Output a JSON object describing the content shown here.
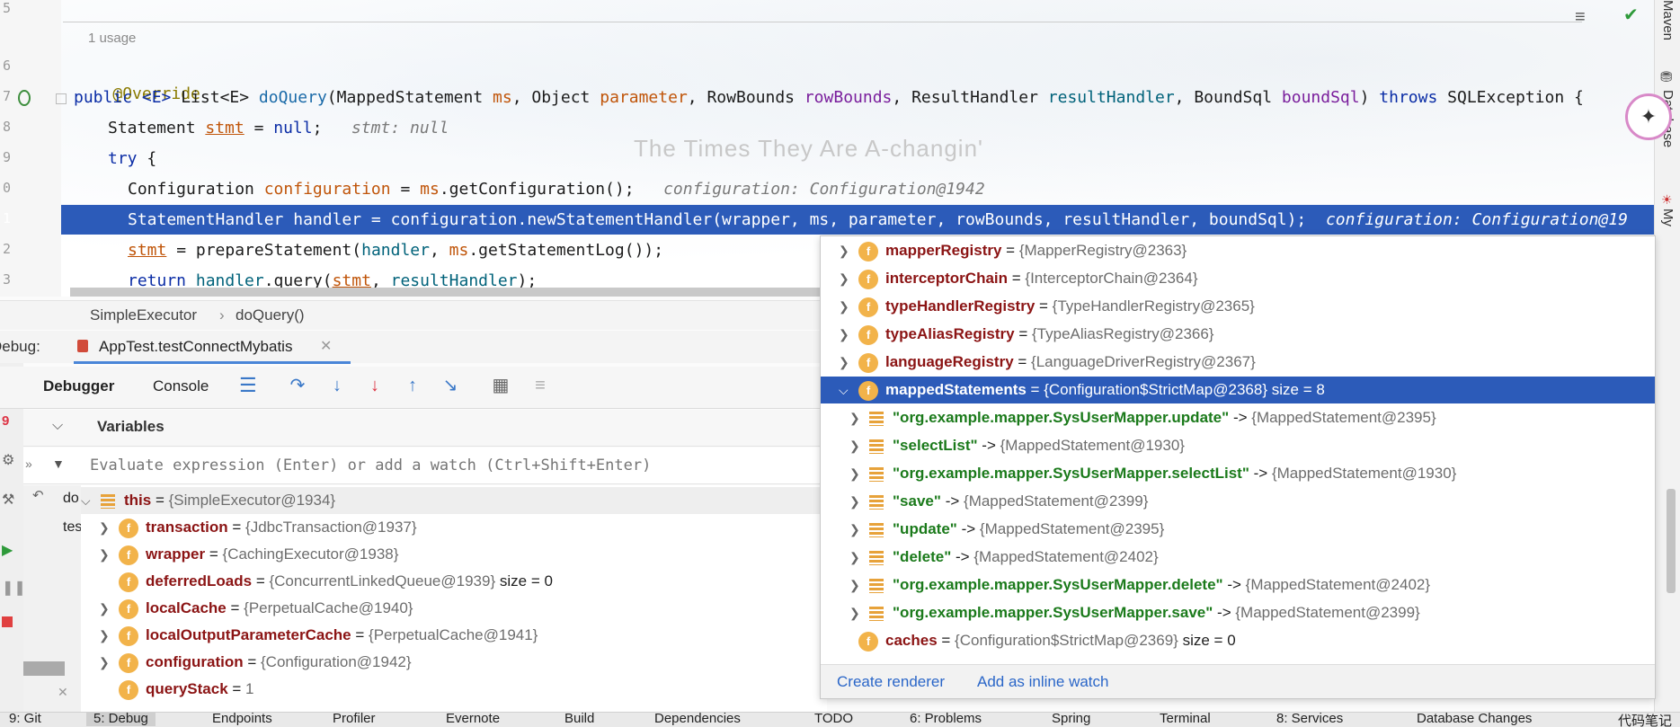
{
  "editor": {
    "line_numbers": [
      "5",
      "6",
      "7",
      "8",
      "9",
      "0",
      "1",
      "2",
      "3"
    ],
    "usage_label": "1 usage",
    "lines": {
      "override": "@Override",
      "sig_public": "public ",
      "sig_generic": "<E> ",
      "sig_ret": "List<E> ",
      "sig_method": "doQuery",
      "sig_p1type": "(MappedStatement ",
      "sig_p1": "ms",
      "sig_p2type": ", Object ",
      "sig_p2": "parameter",
      "sig_p3type": ", RowBounds ",
      "sig_p3": "rowBounds",
      "sig_p4type": ", ResultHandler ",
      "sig_p4": "resultHandler",
      "sig_p5type": ", BoundSql ",
      "sig_p5": "boundSql",
      "sig_close": ") ",
      "sig_throws": "throws",
      "sig_exc": " SQLException {",
      "l8_type": "Statement ",
      "l8_var": "stmt",
      "l8_rest": " = ",
      "l8_null": "null",
      "l8_end": ";",
      "l8_hint": "stmt: null",
      "l9_try": "try",
      "l9_brace": " {",
      "l10_type": "Configuration ",
      "l10_var": "configuration",
      "l10_eq": " = ",
      "l10_ms": "ms",
      "l10_call": ".getConfiguration();",
      "l10_hint": "configuration: Configuration@1942",
      "l11_code": "StatementHandler handler = configuration.newStatementHandler(wrapper, ms, parameter, rowBounds, resultHandler, boundSql);",
      "l11_hint": "configuration: Configuration@19",
      "l12_var": "stmt",
      "l12_eq": " = prepareStatement(",
      "l12_handler": "handler",
      "l12_comma": ", ",
      "l12_ms": "ms",
      "l12_rest": ".getStatementLog());",
      "l13_return": "return ",
      "l13_handler": "handler",
      "l13_query": ".query(",
      "l13_stmt": "stmt",
      "l13_comma": ", ",
      "l13_rh": "resultHandler",
      "l13_end": ");"
    }
  },
  "breadcrumb": {
    "class": "SimpleExecutor",
    "sep": "›",
    "method": "doQuery()"
  },
  "debug": {
    "label": "Debug:",
    "session": "AppTest.testConnectMybatis",
    "tabs": {
      "debugger": "Debugger",
      "console": "Console"
    },
    "variables_label": "Variables",
    "eval_placeholder": "Evaluate expression (Enter) or add a watch (Ctrl+Shift+Enter)",
    "frames": {
      "f1": "do",
      "f2": "tes"
    }
  },
  "variables": [
    {
      "name": "this",
      "value": "{SimpleExecutor@1934}",
      "extra": ""
    },
    {
      "name": "transaction",
      "value": "{JdbcTransaction@1937}",
      "extra": ""
    },
    {
      "name": "wrapper",
      "value": "{CachingExecutor@1938}",
      "extra": ""
    },
    {
      "name": "deferredLoads",
      "value": "{ConcurrentLinkedQueue@1939}",
      "extra": "size = 0"
    },
    {
      "name": "localCache",
      "value": "{PerpetualCache@1940}",
      "extra": ""
    },
    {
      "name": "localOutputParameterCache",
      "value": "{PerpetualCache@1941}",
      "extra": ""
    },
    {
      "name": "configuration",
      "value": "{Configuration@1942}",
      "extra": ""
    },
    {
      "name": "queryStack",
      "value": "1",
      "extra": ""
    }
  ],
  "popup": {
    "fields": [
      {
        "name": "mapperRegistry",
        "value": "{MapperRegistry@2363}"
      },
      {
        "name": "interceptorChain",
        "value": "{InterceptorChain@2364}"
      },
      {
        "name": "typeHandlerRegistry",
        "value": "{TypeHandlerRegistry@2365}"
      },
      {
        "name": "typeAliasRegistry",
        "value": "{TypeAliasRegistry@2366}"
      },
      {
        "name": "languageRegistry",
        "value": "{LanguageDriverRegistry@2367}"
      }
    ],
    "selected": {
      "name": "mappedStatements",
      "value": "{Configuration$StrictMap@2368}",
      "extra": "size = 8"
    },
    "entries": [
      {
        "key": "\"org.example.mapper.SysUserMapper.update\"",
        "value": "{MappedStatement@2395}"
      },
      {
        "key": "\"selectList\"",
        "value": "{MappedStatement@1930}"
      },
      {
        "key": "\"org.example.mapper.SysUserMapper.selectList\"",
        "value": "{MappedStatement@1930}"
      },
      {
        "key": "\"save\"",
        "value": "{MappedStatement@2399}"
      },
      {
        "key": "\"update\"",
        "value": "{MappedStatement@2395}"
      },
      {
        "key": "\"delete\"",
        "value": "{MappedStatement@2402}"
      },
      {
        "key": "\"org.example.mapper.SysUserMapper.delete\"",
        "value": "{MappedStatement@2402}"
      },
      {
        "key": "\"org.example.mapper.SysUserMapper.save\"",
        "value": "{MappedStatement@2399}"
      }
    ],
    "arrow": "->",
    "last": {
      "name": "caches",
      "value": "{Configuration$StrictMap@2369}",
      "extra": "size = 0"
    },
    "create_renderer": "Create renderer",
    "add_inline_watch": "Add as inline watch"
  },
  "rightstrip": {
    "maven": "Maven",
    "database": "Database",
    "my": "My"
  },
  "statusbar": [
    "9: Git",
    "5: Debug",
    "Endpoints",
    "Profiler",
    "Evernote",
    "Build",
    "Dependencies",
    "TODO",
    "6: Problems",
    "Spring",
    "Terminal",
    "8: Services",
    "Database Changes",
    "代码笔记"
  ],
  "faded_title": "The Times They Are A-changin'",
  "colors": {
    "accent": "#2c5bb9",
    "field_icon": "#f2b34a",
    "string": "#1b7a1b"
  }
}
